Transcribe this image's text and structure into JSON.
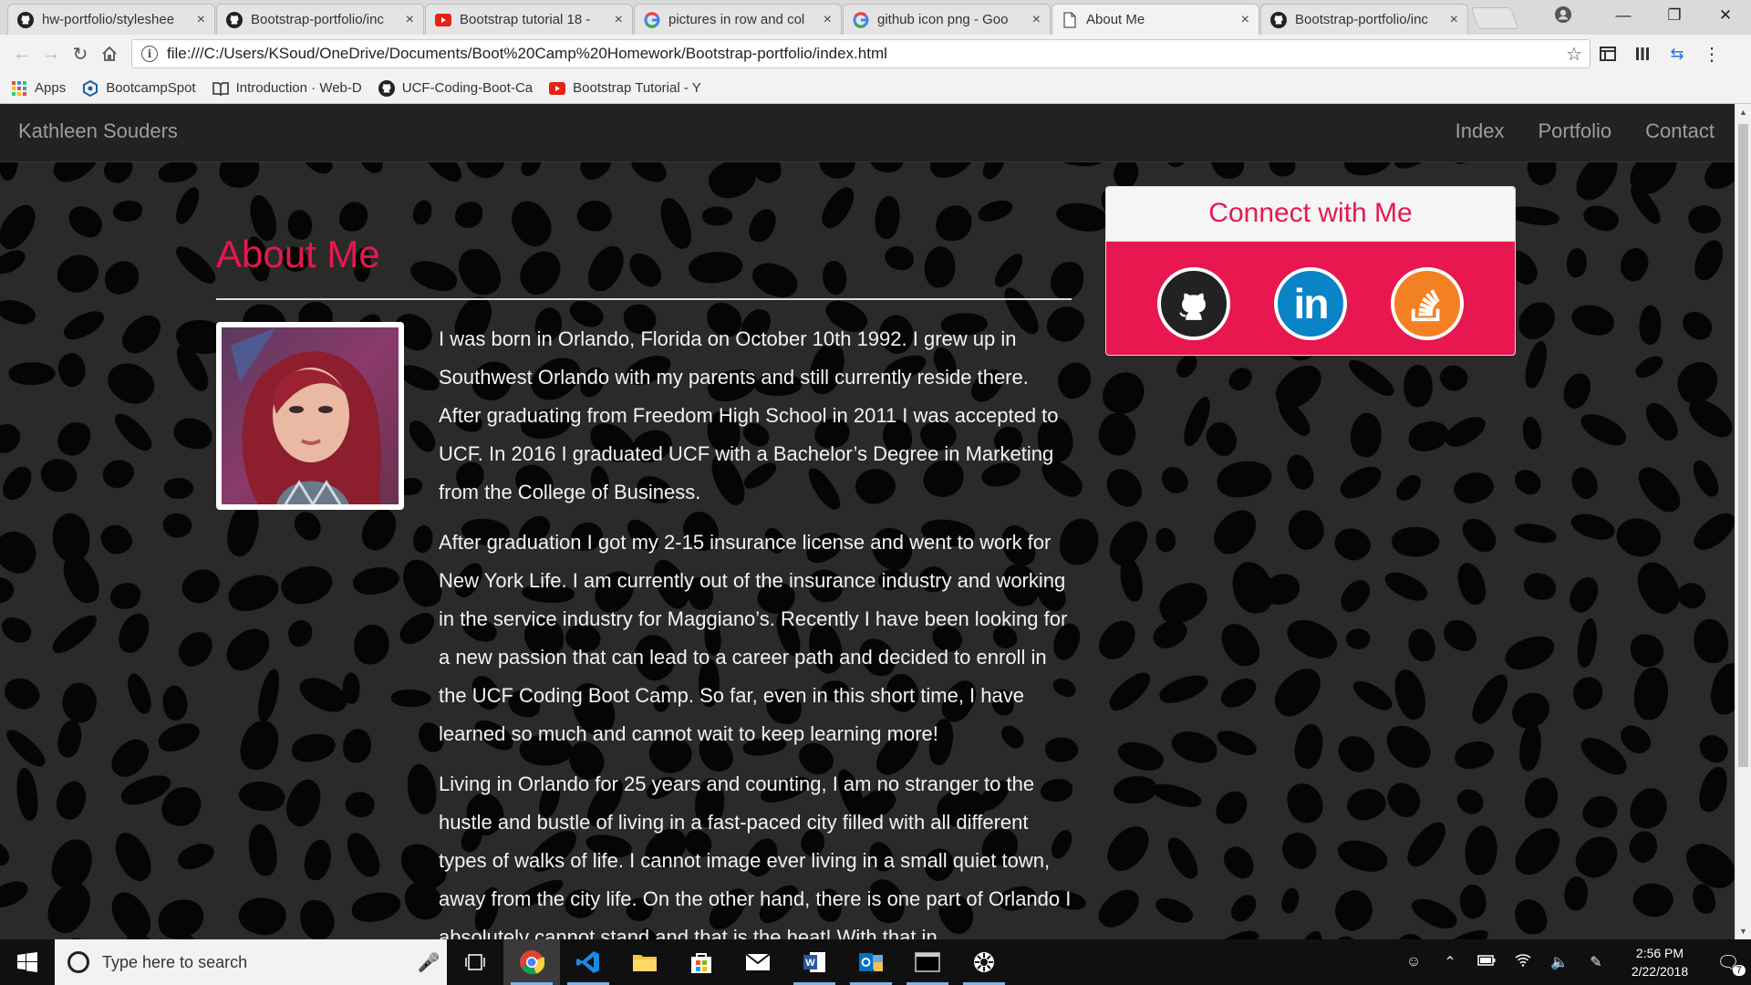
{
  "browser": {
    "tabs": [
      {
        "title": "hw-portfolio/styleshee",
        "icon": "github-icon",
        "active": false
      },
      {
        "title": "Bootstrap-portfolio/inc",
        "icon": "github-icon",
        "active": false
      },
      {
        "title": "Bootstrap tutorial 18 -",
        "icon": "youtube-icon",
        "active": false
      },
      {
        "title": "pictures in row and col",
        "icon": "google-icon",
        "active": false
      },
      {
        "title": "github icon png - Goo",
        "icon": "google-icon",
        "active": false
      },
      {
        "title": "About Me",
        "icon": "page-icon",
        "active": true
      },
      {
        "title": "Bootstrap-portfolio/inc",
        "icon": "github-icon",
        "active": false
      }
    ],
    "url": "file:///C:/Users/KSoud/OneDrive/Documents/Boot%20Camp%20Homework/Bootstrap-portfolio/index.html",
    "bookmarks": [
      {
        "label": "Apps",
        "icon": "apps-grid-icon"
      },
      {
        "label": "BootcampSpot",
        "icon": "bootcampspot-icon"
      },
      {
        "label": "Introduction · Web-D",
        "icon": "book-icon"
      },
      {
        "label": "UCF-Coding-Boot-Ca",
        "icon": "github-icon"
      },
      {
        "label": "Bootstrap Tutorial - Y",
        "icon": "youtube-icon"
      }
    ]
  },
  "site": {
    "brand": "Kathleen Souders",
    "nav": [
      "Index",
      "Portfolio",
      "Contact"
    ],
    "heading": "About Me",
    "bio": [
      "I was born in Orlando, Florida on October 10th 1992. I grew up in Southwest Orlando with my parents and still currently reside there. After graduating from Freedom High School in 2011 I was accepted to UCF. In 2016 I graduated UCF with a Bachelor’s Degree in Marketing from the College of Business.",
      "After graduation I got my 2-15 insurance license and went to work for New York Life. I am currently out of the insurance industry and working in the service industry for Maggiano’s. Recently I have been looking for a new passion that can lead to a career path and decided to enroll in the UCF Coding Boot Camp. So far, even in this short time, I have learned so much and cannot wait to keep learning more!",
      "Living in Orlando for 25 years and counting, I am no stranger to the hustle and bustle of living in a fast-paced city filled with all different types of walks of life. I cannot image ever living in a small quiet town, away from the city life. On the other hand, there is one part of Orlando I absolutely cannot stand and that is the heat! With that in"
    ],
    "connect": {
      "title": "Connect with Me",
      "links": [
        {
          "icon": "github-icon"
        },
        {
          "icon": "linkedin-icon"
        },
        {
          "icon": "stackoverflow-icon"
        }
      ]
    },
    "colors": {
      "accent": "#e8174f",
      "navbar": "#222222"
    }
  },
  "taskbar": {
    "search_placeholder": "Type here to search",
    "apps": [
      "chrome-icon",
      "vscode-icon",
      "file-explorer-icon",
      "store-icon",
      "mail-icon",
      "word-icon",
      "outlook-icon",
      "terminal-icon",
      "settings-app-icon"
    ],
    "time": "2:56 PM",
    "date": "2/22/2018",
    "notification_count": "7"
  }
}
